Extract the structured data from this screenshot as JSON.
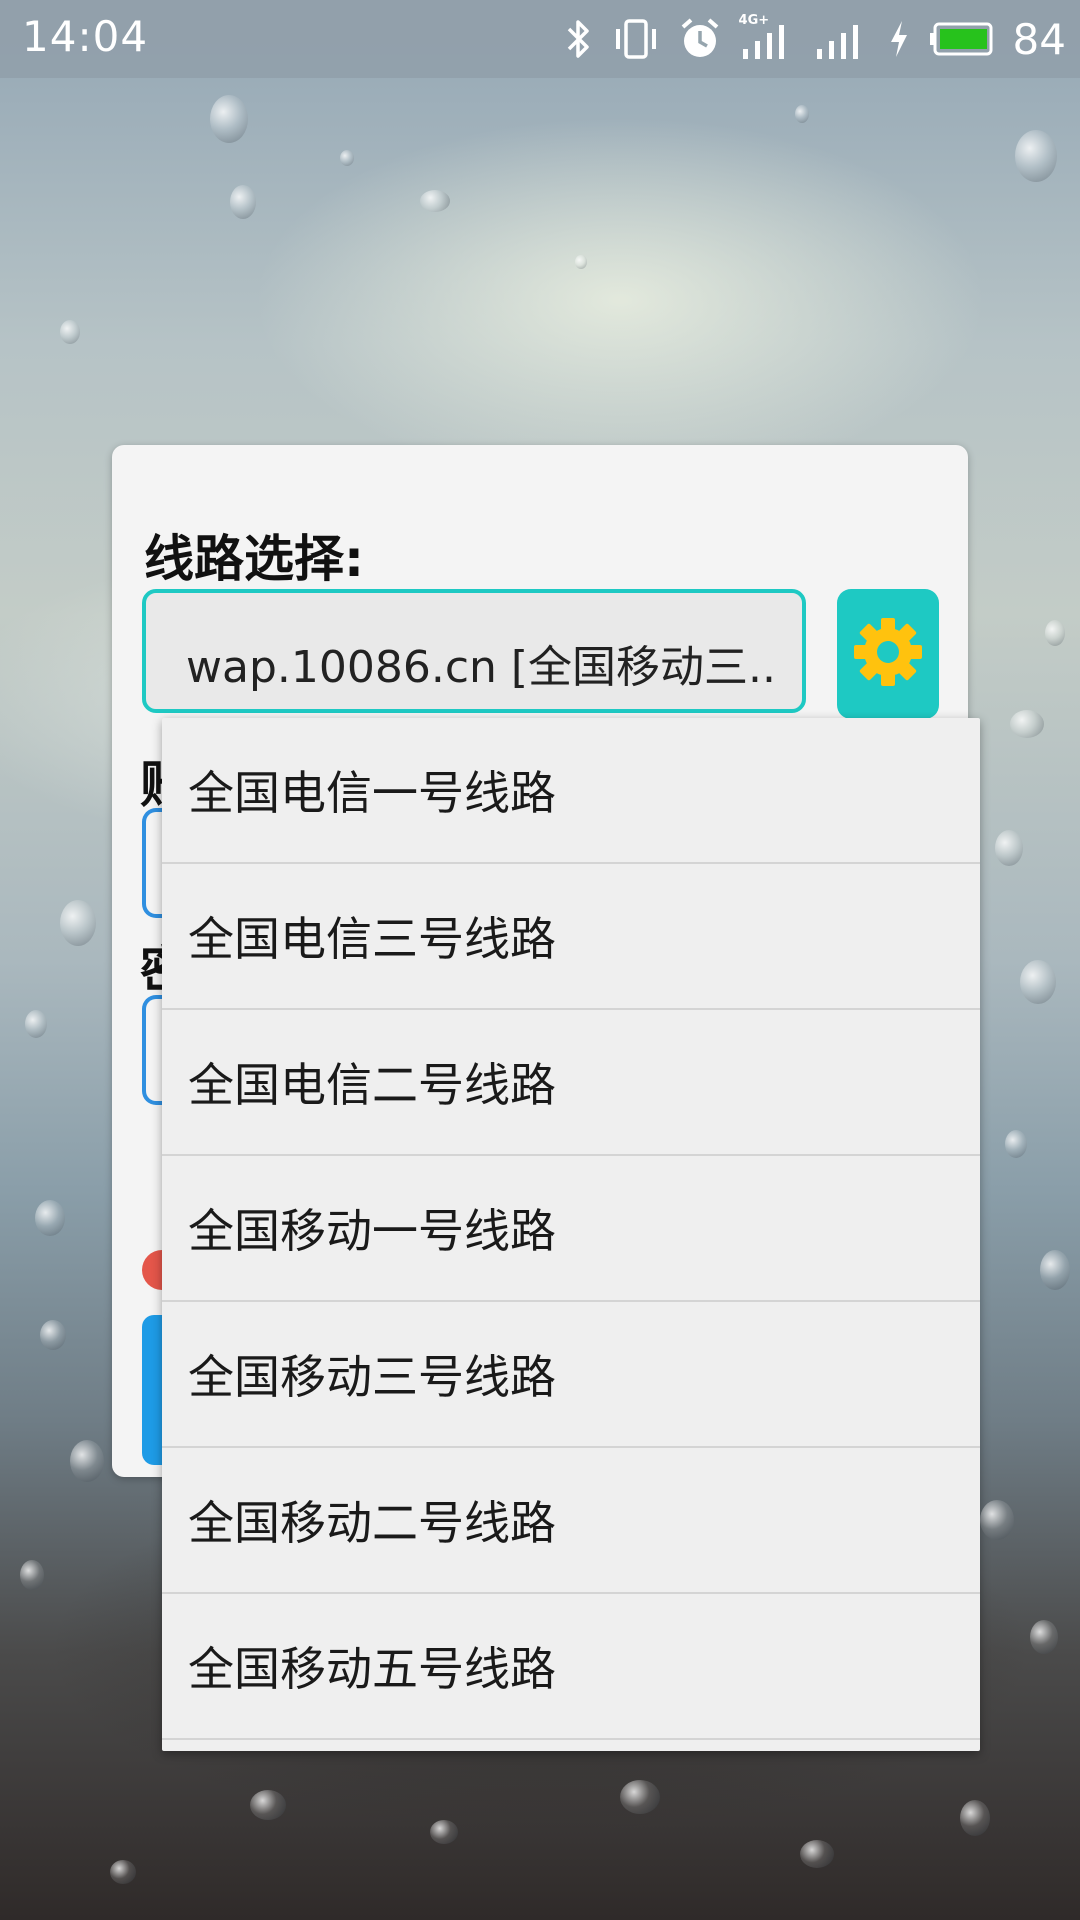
{
  "status_bar": {
    "time": "14:04",
    "network_label": "4G+",
    "battery_level": "84",
    "icons": [
      "bluetooth-icon",
      "vibrate-icon",
      "alarm-icon",
      "signal-4g-icon",
      "signal-icon",
      "charging-icon",
      "battery-icon"
    ]
  },
  "dialog": {
    "line_select_label": "线路选择:",
    "line_select_value": "wap.10086.cn [全国移动三..",
    "settings_icon": "gear-icon",
    "account_label_partial": "账",
    "password_label_partial": "密"
  },
  "dropdown": {
    "items": [
      "全国电信一号线路",
      "全国电信三号线路",
      "全国电信二号线路",
      "全国移动一号线路",
      "全国移动三号线路",
      "全国移动二号线路",
      "全国移动五号线路"
    ]
  },
  "colors": {
    "accent": "#1ec9c3",
    "gear": "#ffc20e",
    "field_border": "#2f8fe0",
    "dot": "#e4564a",
    "button": "#1e9be6",
    "battery": "#27c21c"
  }
}
